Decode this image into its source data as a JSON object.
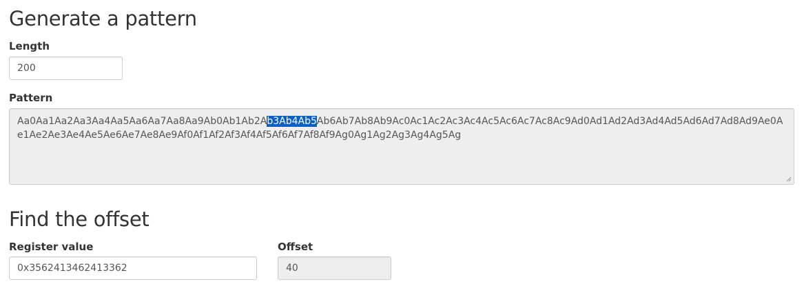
{
  "generate_section": {
    "title": "Generate a pattern",
    "length_label": "Length",
    "length_value": "200",
    "pattern_label": "Pattern",
    "pattern_before": "Aa0Aa1Aa2Aa3Aa4Aa5Aa6Aa7Aa8Aa9Ab0Ab1Ab2A",
    "pattern_selected": "b3Ab4Ab5",
    "pattern_after": "Ab6Ab7Ab8Ab9Ac0Ac1Ac2Ac3Ac4Ac5Ac6Ac7Ac8Ac9Ad0Ad1Ad2Ad3Ad4Ad5Ad6Ad7Ad8Ad9Ae0Ae1Ae2Ae3Ae4Ae5Ae6Ae7Ae8Ae9Af0Af1Af2Af3Af4Af5Af6Af7Af8Af9Ag0Ag1Ag2Ag3Ag4Ag5Ag"
  },
  "offset_section": {
    "title": "Find the offset",
    "register_label": "Register value",
    "register_value": "0x3562413462413362",
    "offset_label": "Offset",
    "offset_value": "40"
  },
  "colors": {
    "selection": "#0a5ec8",
    "readonly_bg": "#eeeeee"
  }
}
